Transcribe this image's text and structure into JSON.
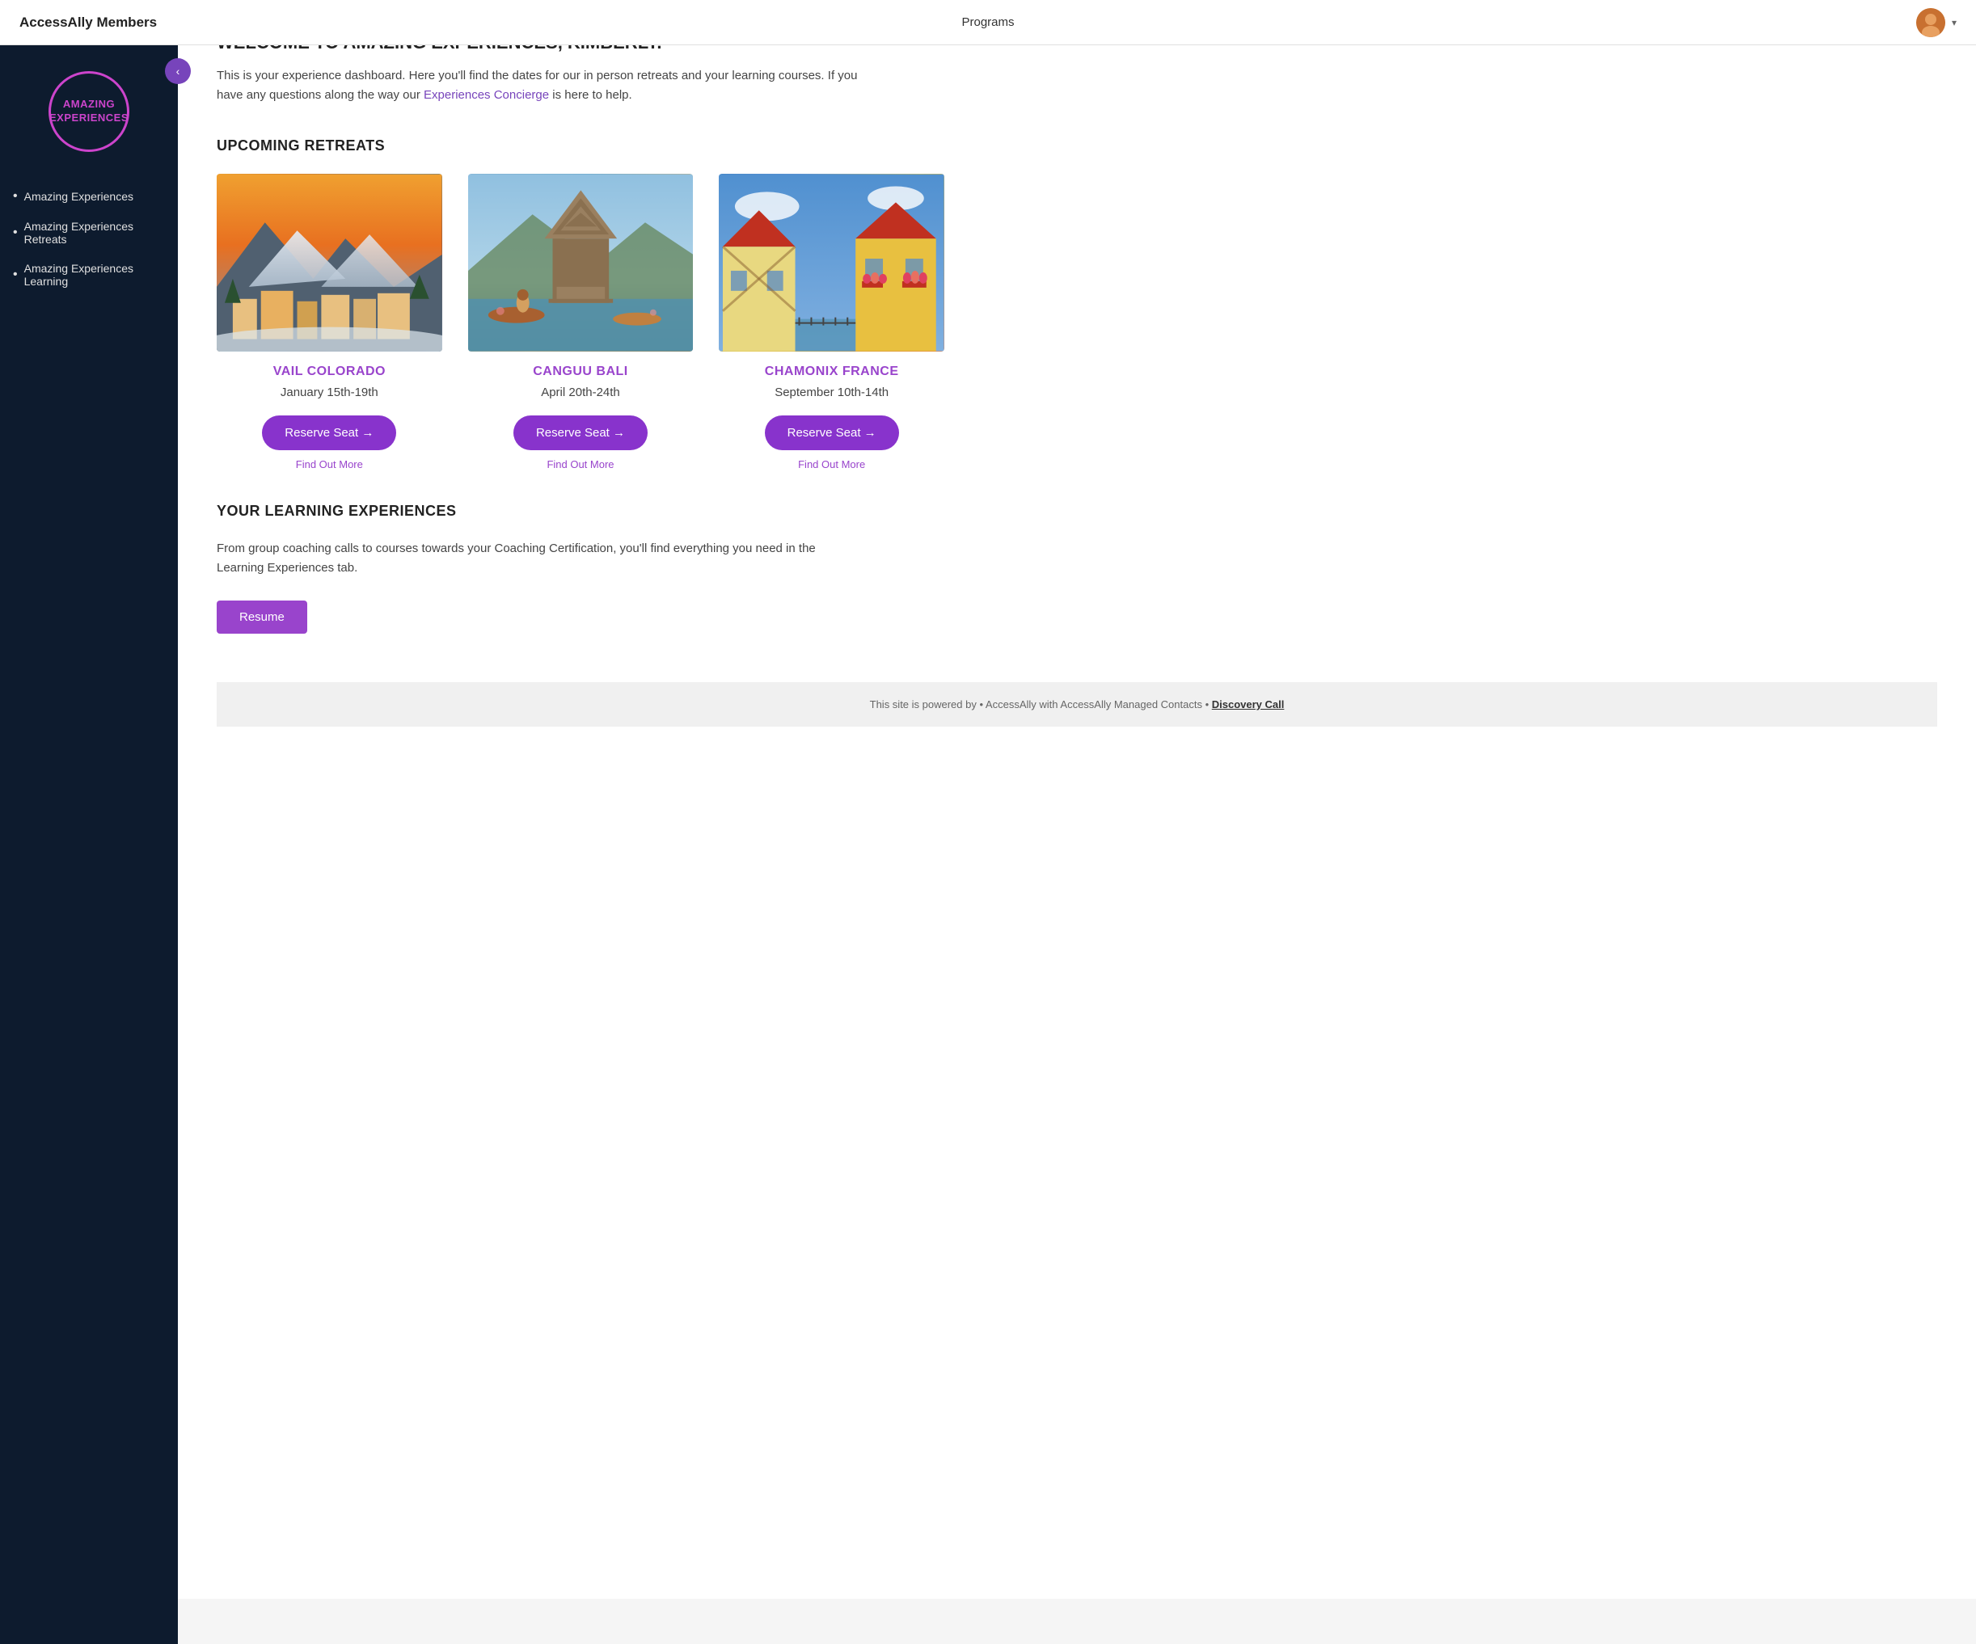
{
  "app": {
    "brand": "AccessAlly Members",
    "nav_link": "Programs",
    "collapse_icon": "‹"
  },
  "sidebar": {
    "logo_line1": "AMAZING",
    "logo_line2": "EXPERIENCES",
    "items": [
      {
        "label": "Amazing Experiences"
      },
      {
        "label": "Amazing Experiences Retreats"
      },
      {
        "label": "Amazing Experiences Learning"
      }
    ]
  },
  "main": {
    "welcome_title": "WELCOME TO AMAZING EXPERIENCES, KIMBERLY.",
    "welcome_desc_pre": "This is your experience dashboard. Here you'll find the dates for our in person retreats and your learning courses. If you have any questions along the way our ",
    "welcome_link_text": "Experiences Concierge",
    "welcome_desc_post": " is here to help.",
    "retreats_section_title": "UPCOMING RETREATS",
    "retreats": [
      {
        "location": "VAIL COLORADO",
        "dates": "January 15th-19th",
        "reserve_label": "Reserve Seat →",
        "find_more_label": "Find Out More",
        "img_type": "vail"
      },
      {
        "location": "CANGUU BALI",
        "dates": "April 20th-24th",
        "reserve_label": "Reserve Seat →",
        "find_more_label": "Find Out More",
        "img_type": "bali"
      },
      {
        "location": "CHAMONIX FRANCE",
        "dates": "September 10th-14th",
        "reserve_label": "Reserve Seat →",
        "find_more_label": "Find Out More",
        "img_type": "chamonix"
      }
    ],
    "learning_title": "YOUR LEARNING EXPERIENCES",
    "learning_desc": "From group coaching calls to courses towards your Coaching Certification, you'll find everything you need in the Learning Experiences tab.",
    "resume_label": "Resume"
  },
  "footer": {
    "text_pre": "This site is powered by • AccessAlly with AccessAlly Managed Contacts • ",
    "link_text": "Discovery Call"
  }
}
